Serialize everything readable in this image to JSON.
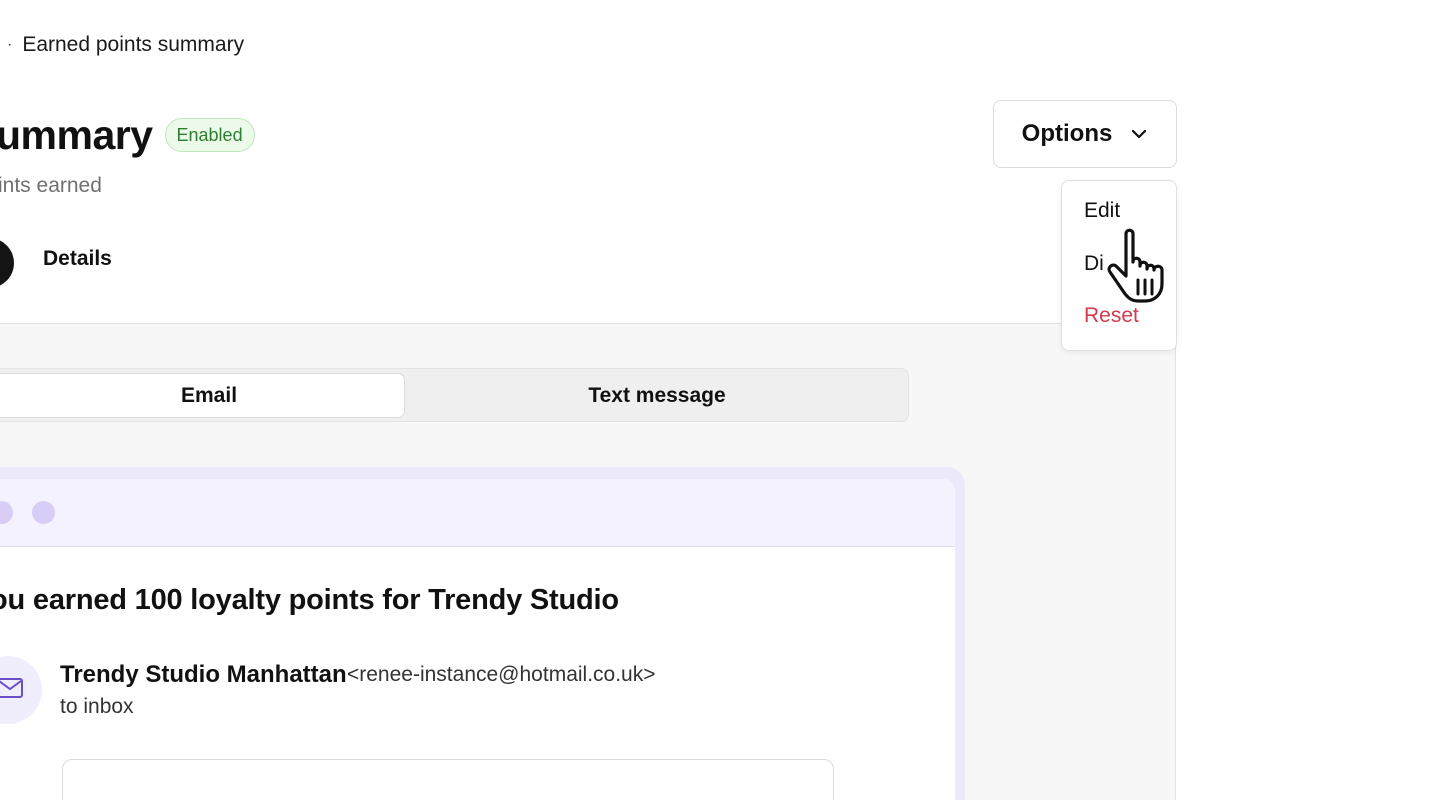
{
  "breadcrumb": {
    "separator": "·",
    "current": "Earned points summary"
  },
  "page": {
    "title": "ummary",
    "status_badge": "Enabled",
    "subtitle": "ints earned"
  },
  "tabs": {
    "details_label": "Details"
  },
  "options": {
    "button_label": "Options",
    "menu": [
      "Edit",
      "Di",
      "Reset"
    ]
  },
  "channel_toggle": {
    "email_label": "Email",
    "text_label": "Text message",
    "selected": "Email"
  },
  "email_preview": {
    "subject": "ou earned 100 loyalty points for Trendy Studio",
    "sender_name": "Trendy Studio Manhattan",
    "sender_email": "<renee-instance@hotmail.co.uk>",
    "recipient_line": "to inbox"
  },
  "colors": {
    "badge_bg": "#ecfbe9",
    "badge_text": "#2f7d32",
    "danger": "#d33a4a",
    "preview_accent": "#ece9fb"
  }
}
